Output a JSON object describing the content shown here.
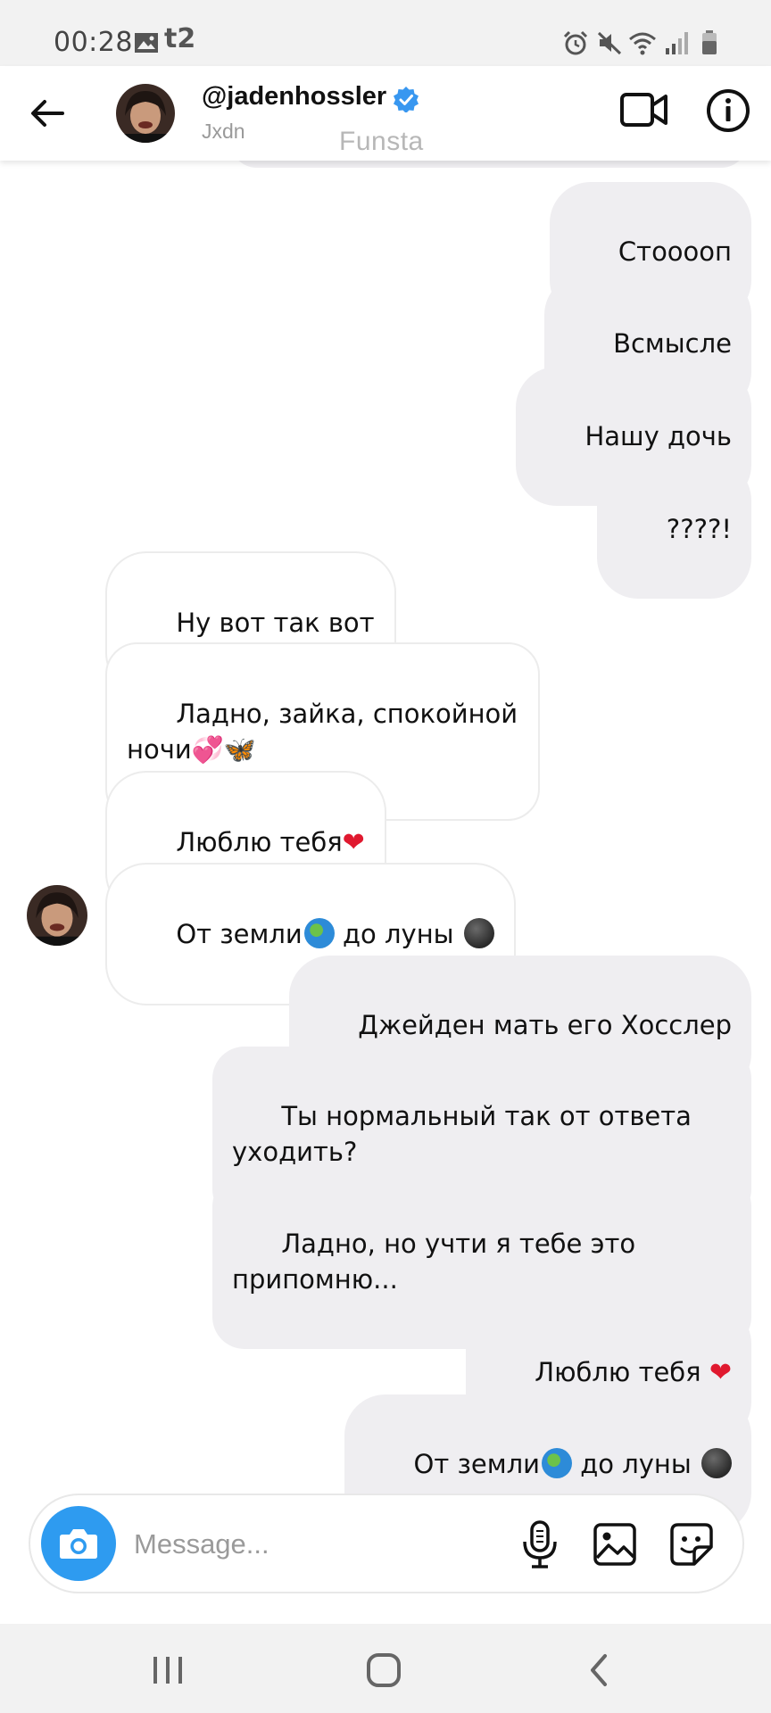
{
  "status_bar": {
    "time": "00:28",
    "carrier": "t2",
    "icons": [
      "gallery-icon",
      "alarm-icon",
      "mute-icon",
      "wifi-icon",
      "signal-icon",
      "battery-icon"
    ]
  },
  "header": {
    "username": "@jadenhossler",
    "subtitle": "Jxdn",
    "watermark": "Funsta",
    "icons": [
      "back-arrow-icon",
      "verified-badge-icon",
      "video-call-icon",
      "info-icon"
    ]
  },
  "messages": [
    {
      "from": "me",
      "text": "Стоoooп"
    },
    {
      "from": "me",
      "text": "Всмысле"
    },
    {
      "from": "me",
      "text": "Нашу дочь"
    },
    {
      "from": "me",
      "text": "????!"
    },
    {
      "from": "them",
      "text": "Ну вот так вот"
    },
    {
      "from": "them",
      "text": "Ладно, зайка, спокойной\nночи",
      "emoji": "💞🦋"
    },
    {
      "from": "them",
      "text": "Люблю тебя",
      "emoji": "❤"
    },
    {
      "from": "them",
      "text_a": "От земли",
      "text_b": " до луны ",
      "emoji": "🌎🌑"
    },
    {
      "from": "me",
      "text": "Джейден мать его Хосслер"
    },
    {
      "from": "me",
      "text": "Ты нормальный так от ответа\nуходить?"
    },
    {
      "from": "me",
      "text": "Ладно, но учти я тебе это\nприпомню..."
    },
    {
      "from": "me",
      "text": "Люблю тебя ",
      "emoji": "❤"
    },
    {
      "from": "me",
      "text_a": "От земли",
      "text_b": " до луны ",
      "emoji": "🌎🌑"
    }
  ],
  "composer": {
    "placeholder": "Message...",
    "icons": [
      "camera-icon",
      "microphone-icon",
      "gallery-icon",
      "sticker-icon"
    ]
  },
  "colors": {
    "accent": "#2e9bf0",
    "outgoing_bubble": "#efeef1",
    "incoming_border": "#ececec"
  }
}
